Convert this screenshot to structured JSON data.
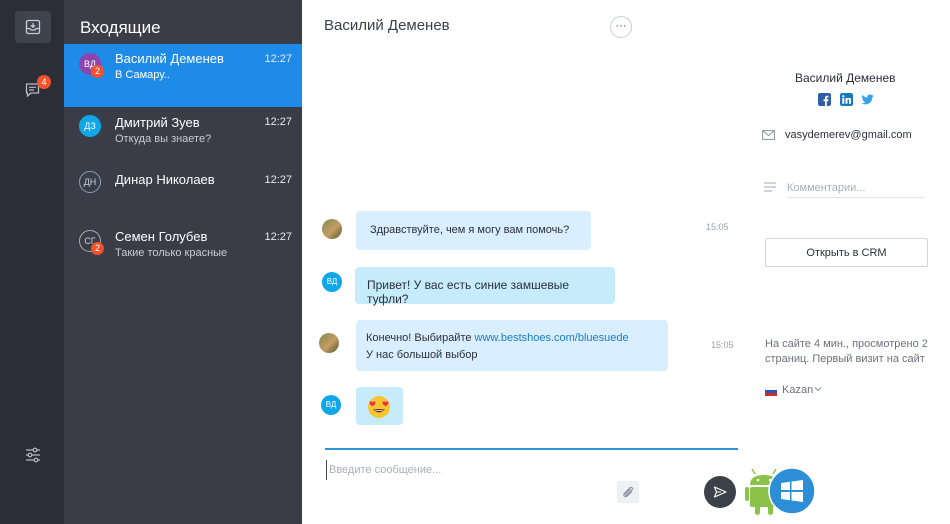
{
  "rail": {
    "badge_count": "4",
    "icons": [
      "inbox-icon",
      "chat-icon",
      "settings-sliders-icon"
    ]
  },
  "list": {
    "title": "Входящие",
    "conversations": [
      {
        "initials": "ВД",
        "name": "Василий Деменев",
        "time": "12:27",
        "message": "В Самару..",
        "unread": "2",
        "active": true
      },
      {
        "initials": "ДЗ",
        "name": "Дмитрий Зуев",
        "time": "12:27",
        "message": "Откуда вы знаете?",
        "unread": "",
        "active": false
      },
      {
        "initials": "ДН",
        "name": "Динар Николаев",
        "time": "12:27",
        "message": "",
        "unread": "",
        "active": false
      },
      {
        "initials": "СГ",
        "name": "Семен Голубев",
        "time": "12:27",
        "message": "Такие только красные",
        "unread": "2",
        "active": false
      }
    ]
  },
  "chat": {
    "title": "Василий Деменев",
    "more_label": "···",
    "messages": [
      {
        "from": "operator",
        "text": "Здравствуйте, чем я могу вам помочь?",
        "time": "15:05"
      },
      {
        "from": "visitor",
        "initials": "ВД",
        "text": "Привет! У вас есть синие замшевые туфли?"
      },
      {
        "from": "operator",
        "text_before_link": "Конечно! Выбирайте ",
        "link": "www.bestshoes.com/bluesuede",
        "line2": "У нас большой выбор",
        "time": "15:05"
      },
      {
        "from": "visitor",
        "initials": "ВД",
        "emoji": "heart-eyes-emoji"
      }
    ],
    "composer_placeholder": "Введите сообщение..."
  },
  "profile": {
    "name": "Василий Деменев",
    "social": [
      "facebook-icon",
      "linkedin-icon",
      "twitter-icon"
    ],
    "email": "vasydemerev@gmail.com",
    "comment_placeholder": "Комментарии...",
    "crm_button": "Открыть в CRM",
    "visit_info": "На сайте 4 мин., просмотрено 2 страниц. Первый визит на сайт",
    "city": "Kazan"
  },
  "colors": {
    "accent": "#1e8be8",
    "rail_bg": "#2b2e36",
    "list_bg": "#3a3d47",
    "badge": "#f4512c",
    "bubble_operator": "#d9efff",
    "bubble_visitor": "#c6ecfc"
  }
}
